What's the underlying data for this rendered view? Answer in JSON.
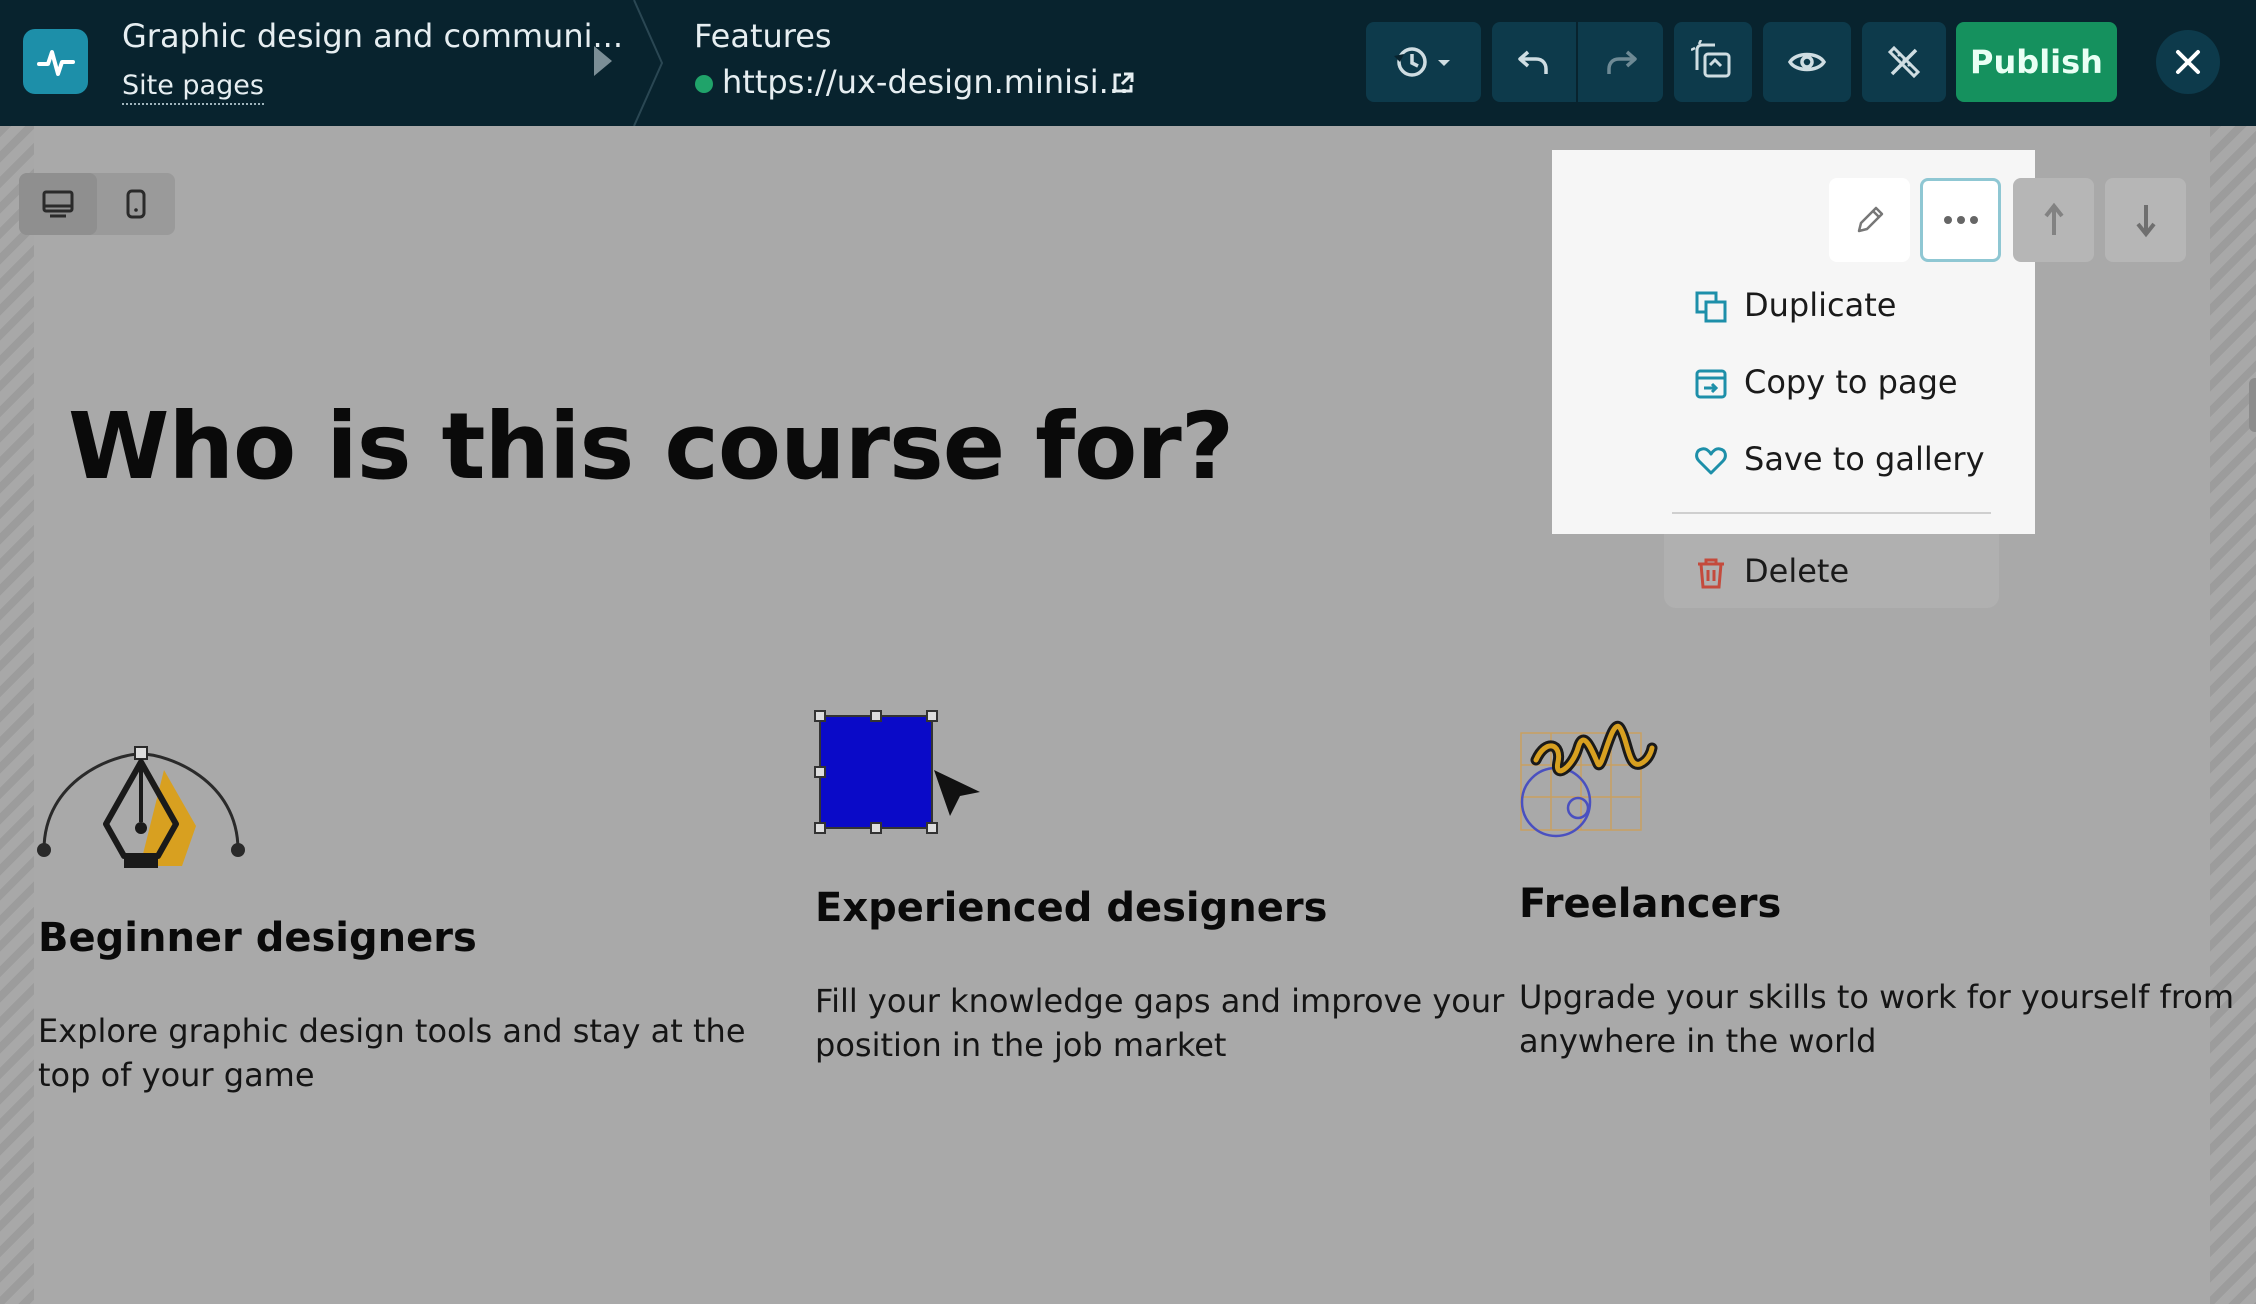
{
  "header": {
    "site_title": "Graphic design and communi...",
    "site_pages_label": "Site pages",
    "page_name": "Features",
    "page_url": "https://ux-design.minisi...",
    "publish_label": "Publish"
  },
  "icons": {
    "logo": "pulse-icon",
    "history": "history-icon",
    "undo": "undo-icon",
    "redo": "redo-icon",
    "ai": "ai-assistant-icon",
    "preview": "eye-icon",
    "design": "design-tools-icon",
    "close": "close-icon"
  },
  "canvas": {
    "heading": "Who is this course for?",
    "cards": [
      {
        "title": "Beginner designers",
        "description": "Explore graphic design tools and stay at the top of your game",
        "icon": "pen-tool-icon"
      },
      {
        "title": "Experienced designers",
        "description": "Fill your knowledge gaps and improve your position in the job market",
        "icon": "selected-square-icon"
      },
      {
        "title": "Freelancers",
        "description": "Upgrade your skills to work for yourself from anywhere in the world",
        "icon": "scribble-grid-icon"
      }
    ]
  },
  "context_menu": {
    "items": [
      {
        "label": "Duplicate",
        "icon": "duplicate-icon"
      },
      {
        "label": "Copy to page",
        "icon": "copy-to-page-icon"
      },
      {
        "label": "Save to gallery",
        "icon": "heart-icon"
      },
      {
        "label": "Delete",
        "icon": "trash-icon"
      }
    ]
  },
  "colors": {
    "topbar": "#08232e",
    "accent": "#1d8fa9",
    "publish": "#15915e",
    "delete": "#c44a3c"
  }
}
